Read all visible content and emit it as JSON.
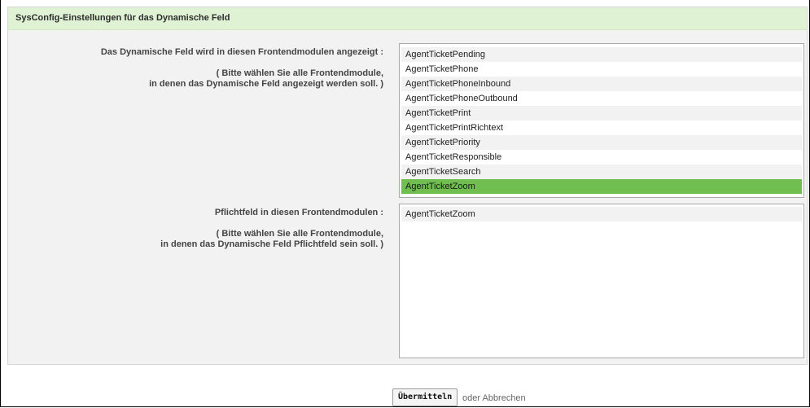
{
  "panel": {
    "title": "SysConfig-Einstellungen für das Dynamische Feld"
  },
  "display_field": {
    "label": "Das Dynamische Feld wird in diesen Frontendmodulen angezeigt :",
    "hint_line1": "( Bitte wählen Sie alle Frontendmodule,",
    "hint_line2": "in denen das Dynamische Feld angezeigt werden soll. )",
    "options": [
      "AgentTicketPending",
      "AgentTicketPhone",
      "AgentTicketPhoneInbound",
      "AgentTicketPhoneOutbound",
      "AgentTicketPrint",
      "AgentTicketPrintRichtext",
      "AgentTicketPriority",
      "AgentTicketResponsible",
      "AgentTicketSearch",
      "AgentTicketZoom"
    ],
    "selected": "AgentTicketZoom"
  },
  "mandatory_field": {
    "label": "Pflichtfeld in diesen Frontendmodulen :",
    "hint_line1": "( Bitte wählen Sie alle Frontendmodule,",
    "hint_line2": "in denen das Dynamische Feld Pflichtfeld sein soll. )",
    "options": [
      "AgentTicketZoom"
    ]
  },
  "footer": {
    "submit_label": "Übermitteln",
    "cancel_label": "oder Abbrechen"
  },
  "colors": {
    "header_bg": "#dff3d4",
    "selected_bg": "#6fbe4f"
  }
}
